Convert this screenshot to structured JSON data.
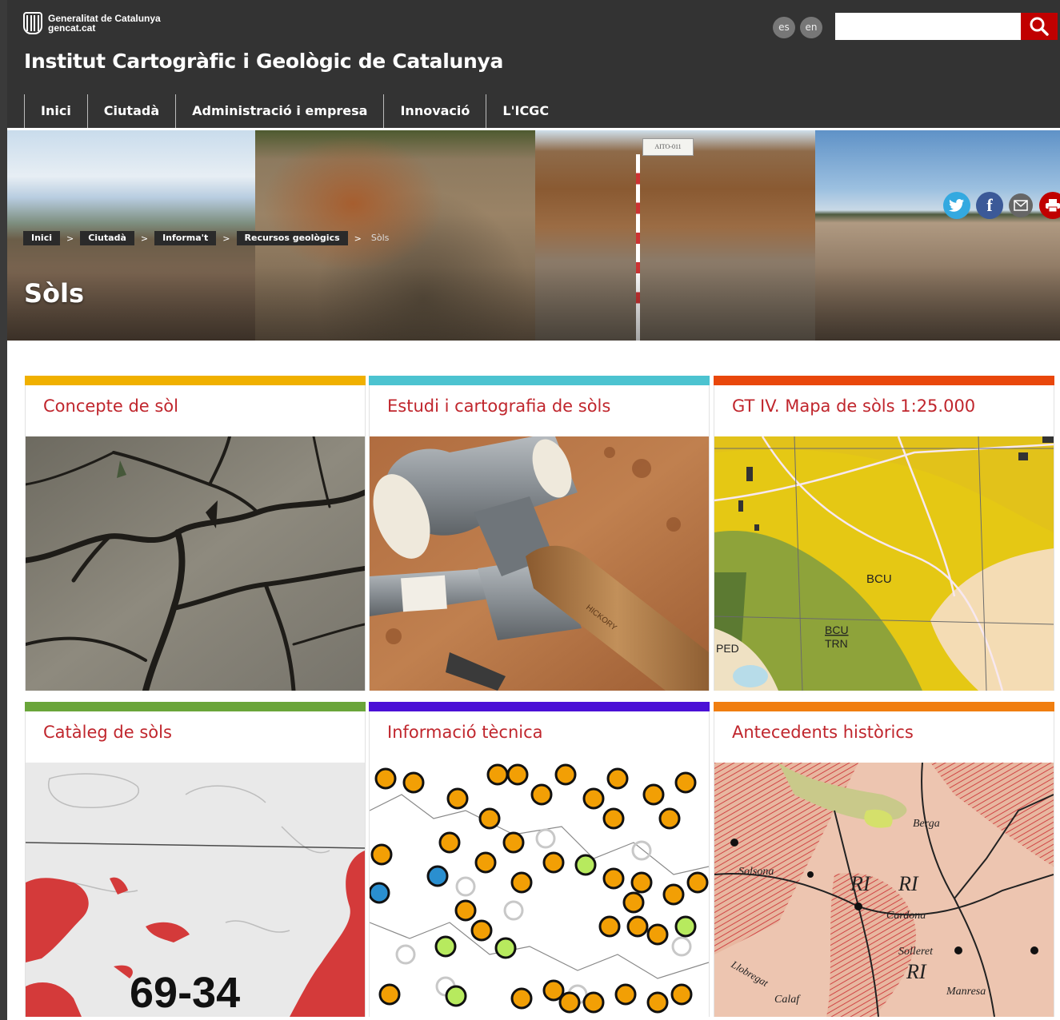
{
  "header": {
    "gencat_line1": "Generalitat de Catalunya",
    "gencat_line2": "gencat.cat",
    "site_title": "Institut Cartogràfic i Geològic de Catalunya",
    "lang_es": "es",
    "lang_en": "en",
    "search_placeholder": ""
  },
  "nav": {
    "items": [
      {
        "label": "Inici"
      },
      {
        "label": "Ciutadà"
      },
      {
        "label": "Administració i empresa"
      },
      {
        "label": "Innovació"
      },
      {
        "label": "L'ICGC"
      }
    ]
  },
  "hero": {
    "breadcrumb": [
      {
        "label": "Inici"
      },
      {
        "label": "Ciutadà"
      },
      {
        "label": "Informa't"
      },
      {
        "label": "Recursos geològics"
      },
      {
        "label": "Sòls"
      }
    ],
    "crumb_separator": ">",
    "title": "Sòls",
    "sign_text": "AITO-011",
    "social_icons": [
      "twitter-icon",
      "facebook-icon",
      "email-icon",
      "print-icon"
    ]
  },
  "cards": [
    {
      "title": "Concepte de sòl",
      "color": "#f0b000"
    },
    {
      "title": "Estudi i cartografia de sòls",
      "color": "#4cc3d0"
    },
    {
      "title": "GT IV. Mapa de sòls 1:25.000",
      "color": "#e9470b"
    },
    {
      "title": "Catàleg de sòls",
      "color": "#6aa53a"
    },
    {
      "title": "Informació tècnica",
      "color": "#4b10d6"
    },
    {
      "title": "Antecedents històrics",
      "color": "#f07e10"
    }
  ],
  "images": {
    "map_labels": [
      "BCU",
      "BCU",
      "TRN",
      "PED"
    ],
    "hammer_text": "HICKORY",
    "catalog_code": "69-34",
    "historic_labels": [
      "RI",
      "RI",
      "RI",
      "Cardona",
      "Solleret",
      "Berga",
      "Calaf",
      "Llobregat",
      "Manresa",
      "Solsona"
    ]
  }
}
